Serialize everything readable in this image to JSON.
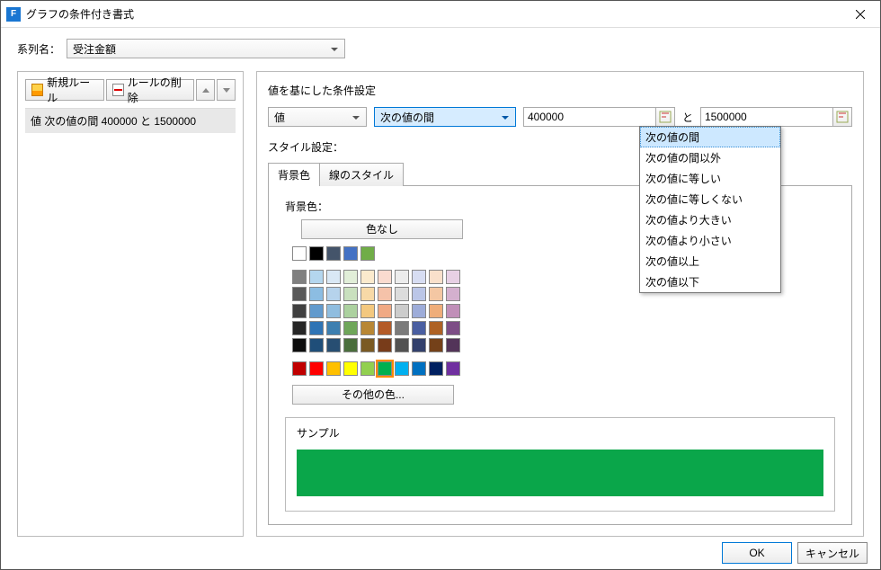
{
  "title": "グラフの条件付き書式",
  "app_icon_letter": "F",
  "series_label": "系列名：",
  "series_value": "受注金額",
  "toolbar": {
    "new_rule": "新規ルール",
    "delete_rule": "ルールの削除"
  },
  "rules": [
    "値 次の値の間 400000 と 1500000"
  ],
  "right": {
    "section_title": "値を基にした条件設定",
    "field_combo": "値",
    "operator_combo": "次の値の間",
    "operator_options": [
      "次の値の間",
      "次の値の間以外",
      "次の値に等しい",
      "次の値に等しくない",
      "次の値より大きい",
      "次の値より小さい",
      "次の値以上",
      "次の値以下"
    ],
    "value1": "400000",
    "between_label": "と",
    "value2": "1500000",
    "style_label": "スタイル設定：",
    "tab_bg": "背景色",
    "tab_line": "線のスタイル",
    "bgcolor_label": "背景色：",
    "no_color": "色なし",
    "more_colors": "その他の色...",
    "sample_label": "サンプル",
    "palette_top": [
      "#ffffff",
      "#000000",
      "#1f2d3a",
      "#244062",
      "#4ba04b",
      "#4ba04b",
      "#4ba04b",
      "#4ba04b",
      "#4ba04b",
      "#4ba04b"
    ],
    "palette_top_real": [
      "#ffffff",
      "#000000",
      "#1f3a5f",
      "#44546a",
      "#5b9bd5",
      "#5b9bd5",
      "#5b9bd5",
      "#5b9bd5",
      "#5b9bd5",
      "#5b9bd5"
    ],
    "palette1": [
      "#ffffff",
      "#000000",
      "#44546a",
      "#4472c4",
      "#70ad47",
      "#ffffff",
      "#000000",
      "#000000",
      "#000000",
      "#000000"
    ],
    "theme_row": [
      "#7f7f7f",
      "#bdd7ee",
      "#deebf7",
      "#e2f0d9",
      "#fdebd3",
      "#fce4d6",
      "#ededed",
      "#d9e2f3",
      "#fbe5d6",
      "#e9d5e7"
    ],
    "std_row": [
      "#c00000",
      "#ff0000",
      "#ffc000",
      "#ffff00",
      "#92d050",
      "#00b050",
      "#00b0f0",
      "#0070c0",
      "#002060",
      "#7030a0"
    ],
    "grid": [
      "#808080",
      "#b4d6ee",
      "#d9e8f5",
      "#e1eed8",
      "#fbeacd",
      "#fadbcf",
      "#ececec",
      "#d7ddf2",
      "#f9e0cb",
      "#e7d0e4",
      "#595959",
      "#8cbde2",
      "#b6d3ec",
      "#c9e0be",
      "#f7d9a7",
      "#f5c2a9",
      "#dcdcdc",
      "#bbc6e7",
      "#f4c7a3",
      "#d4b0ce",
      "#404040",
      "#619acd",
      "#8fbddf",
      "#acd19f",
      "#f3c87f",
      "#f0a984",
      "#cccccc",
      "#9dacd9",
      "#efad7a",
      "#c08fb8",
      "#262626",
      "#2f74b5",
      "#3d7fb0",
      "#6fa65a",
      "#b88735",
      "#b45b28",
      "#7b7b7b",
      "#4a5fa1",
      "#ae6225",
      "#7d4e86",
      "#0d0d0d",
      "#1f4e79",
      "#274e72",
      "#4a6e3c",
      "#7a5a23",
      "#783c1a",
      "#525252",
      "#32406c",
      "#744119",
      "#533459"
    ],
    "selected_color": "#00b050"
  },
  "footer": {
    "ok": "OK",
    "cancel": "キャンセル"
  }
}
